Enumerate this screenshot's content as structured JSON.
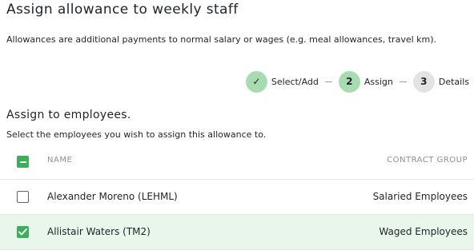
{
  "page": {
    "title": "Assign allowance to weekly staff",
    "description": "Allowances are additional payments to normal salary or wages (e.g. meal allowances, travel km)."
  },
  "stepper": {
    "steps": [
      {
        "marker": "✓",
        "label": "Select/Add",
        "state": "done"
      },
      {
        "marker": "2",
        "label": "Assign",
        "state": "active"
      },
      {
        "marker": "3",
        "label": "Details",
        "state": "todo"
      }
    ]
  },
  "section": {
    "title": "Assign to employees.",
    "subtitle": "Select the employees you wish to assign this allowance to."
  },
  "table": {
    "columns": {
      "name": "NAME",
      "group": "CONTRACT GROUP"
    },
    "select_all_state": "indeterminate",
    "rows": [
      {
        "name": "Alexander Moreno (LEHML)",
        "group": "Salaried Employees",
        "selected": false
      },
      {
        "name": "Allistair Waters (TM2)",
        "group": "Waged Employees",
        "selected": true
      }
    ]
  },
  "colors": {
    "accent": "#3fae5a",
    "step_done": "#a8dbb0",
    "step_todo": "#e3e3e3",
    "selected_row": "#e9f6ec"
  }
}
